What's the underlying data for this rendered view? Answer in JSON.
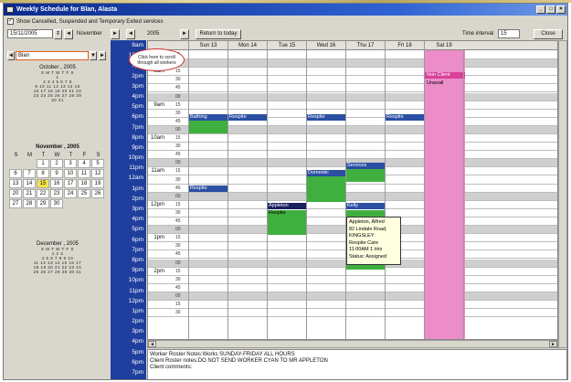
{
  "window": {
    "title": "Weekly Schedule for Blan, Alasta",
    "min": "_",
    "max": "□",
    "close": "×"
  },
  "options": {
    "show_cancelled_label": "Show Cancelled, Suspended and Temporary Exited services",
    "checked": "✓"
  },
  "toolbar": {
    "date_value": "15/11/2005",
    "month_prev": "◄",
    "month_label": "November",
    "month_next": "►",
    "year_prev": "◄",
    "year_label": "2005",
    "year_next": "►",
    "return_label": "Return to today",
    "interval_label": "Time interval",
    "interval_value": "15",
    "close_label": "Close"
  },
  "worker_filter": {
    "value": "Blan",
    "arrow": "▼",
    "prev": "◄",
    "next": "►"
  },
  "calendars": {
    "october": {
      "title": "October , 2005",
      "days_header": "S M T W T F S",
      "rows": [
        "1",
        "2 3 4 5 6 7 8",
        "9 10 11 12 13 14 15",
        "16 17 18 19 20 21 22",
        "23 24 25 26 27 28 29",
        "30 31"
      ]
    },
    "november": {
      "title": "November , 2005",
      "days": [
        "S",
        "M",
        "T",
        "W",
        "T",
        "F",
        "S"
      ],
      "cells": [
        "",
        "",
        "1",
        "2",
        "3",
        "4",
        "5",
        "6",
        "7",
        "8",
        "9",
        "10",
        "11",
        "12",
        "13",
        "14",
        "15",
        "16",
        "17",
        "18",
        "19",
        "20",
        "21",
        "22",
        "23",
        "24",
        "25",
        "26",
        "27",
        "28",
        "29",
        "30",
        "",
        "",
        ""
      ],
      "today_index": 16
    },
    "december": {
      "title": "December , 2005",
      "days_header": "S M T W T F S",
      "rows": [
        "1 2 3",
        "4 5 6 7 8 9 10",
        "11 12 13 14 15 16 17",
        "18 19 20 21 22 23 24",
        "25 26 27 28 29 30 31"
      ]
    }
  },
  "worker_column": [
    "8am",
    "12am",
    "1pm",
    "2pm",
    "3pm",
    "4pm",
    "5pm",
    "6pm",
    "7pm",
    "8pm",
    "9pm",
    "10pm",
    "11pm",
    "12am",
    "1pm",
    "2pm",
    "3pm",
    "4pm",
    "5pm",
    "6pm",
    "7pm",
    "8pm",
    "9pm",
    "10pm",
    "11pm",
    "12pm",
    "1pm",
    "2pm",
    "3pm",
    "4pm",
    "5pm",
    "6pm",
    "7pm"
  ],
  "callout": "Click here to scroll through all workers",
  "grid": {
    "days": [
      "Sun 13",
      "Mon 14",
      "Tue 15",
      "Wed 16",
      "Thu 17",
      "Fri 18",
      "Sat 19"
    ],
    "hours": [
      {
        "label": "",
        "minutes": [
          "45"
        ]
      },
      {
        "label": "8am",
        "minutes": [
          "00",
          "15",
          "30",
          "45"
        ]
      },
      {
        "label": "9am",
        "minutes": [
          "00",
          "15",
          "30",
          "45"
        ]
      },
      {
        "label": "10am",
        "minutes": [
          "00",
          "15",
          "30",
          "45"
        ]
      },
      {
        "label": "11am",
        "minutes": [
          "00",
          "15",
          "30",
          "45"
        ]
      },
      {
        "label": "12pm",
        "minutes": [
          "00",
          "15",
          "30",
          "45"
        ]
      },
      {
        "label": "1pm",
        "minutes": [
          "00",
          "15",
          "30",
          "45"
        ]
      },
      {
        "label": "2pm",
        "minutes": [
          "00",
          "15",
          "30",
          "45"
        ]
      },
      {
        "label": "",
        "minutes": [
          "00",
          "15",
          "30"
        ]
      }
    ],
    "appointments": [
      {
        "label": "Bathing",
        "color": "blue"
      },
      {
        "label": "Respite",
        "color": "blue"
      },
      {
        "label": "Respite",
        "color": "blue"
      },
      {
        "label": "Respite",
        "color": "blue"
      },
      {
        "label": "Domestic",
        "color": "blue"
      },
      {
        "label": "Services",
        "color": "blue"
      },
      {
        "label": "Respite",
        "color": "blue"
      },
      {
        "label": "Appleton",
        "color": "blue"
      },
      {
        "label": "Kelly",
        "color": "blue"
      },
      {
        "label": "Respite",
        "color": "green"
      },
      {
        "label": "Non Client",
        "color": "pink"
      },
      {
        "label": "Unavail",
        "color": "pink"
      }
    ]
  },
  "tooltip": {
    "lines": [
      "Appleton, Alfred",
      "82 Lindale Road, KINGSLEY",
      "Respite Care",
      "11:00AM 1 Hrs",
      "Status: Assigned"
    ]
  },
  "notes": {
    "lines": [
      "Worker Roster Notes:Works SUNDAY-FRIDAY ALL HOURS",
      "Client Roster notes:DO NOT SEND WORKER CYAN TO MR APPLETON",
      "Client comments:"
    ]
  },
  "scroll": {
    "left": "◄",
    "right": "►"
  }
}
